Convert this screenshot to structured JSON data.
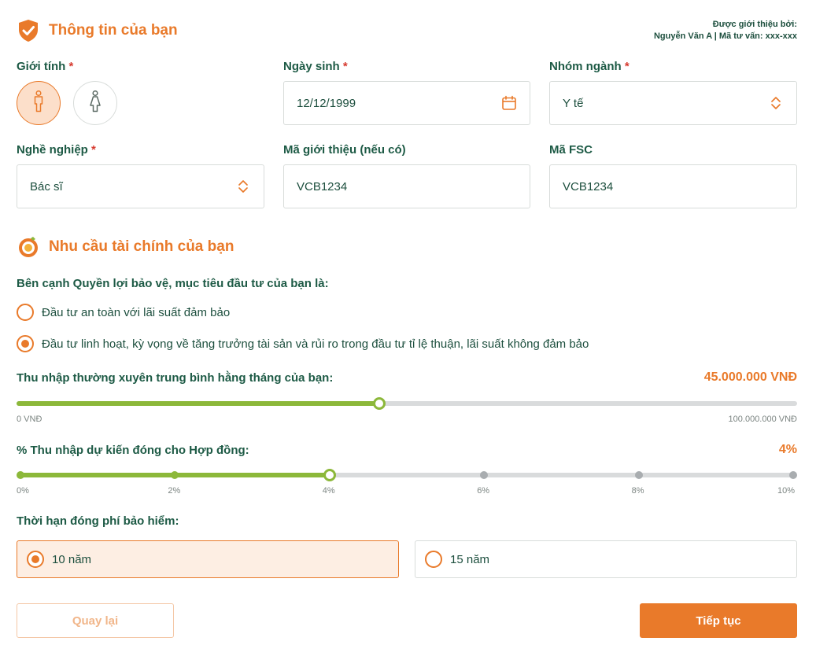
{
  "section1": {
    "title": "Thông tin của bạn",
    "icon": "shield-check-icon",
    "referral": {
      "line1": "Được giới thiệu bởi:",
      "line2": "Nguyễn Văn A | Mã tư vấn: xxx-xxx"
    }
  },
  "gender": {
    "label": "Giới tính",
    "required": "*",
    "options": [
      {
        "name": "male",
        "icon": "male-person-icon",
        "selected": true
      },
      {
        "name": "female",
        "icon": "female-person-icon",
        "selected": false
      }
    ]
  },
  "dob": {
    "label": "Ngày sinh",
    "required": "*",
    "value": "12/12/1999",
    "icon": "calendar-icon"
  },
  "industry": {
    "label": "Nhóm ngành",
    "required": "*",
    "value": "Y tế",
    "icon": "chevron-updown-icon"
  },
  "occupation": {
    "label": "Nghề nghiệp",
    "required": "*",
    "value": "Bác sĩ",
    "icon": "chevron-updown-icon"
  },
  "referral_code": {
    "label": "Mã giới thiệu (nếu có)",
    "value": "VCB1234"
  },
  "fsc_code": {
    "label": "Mã FSC",
    "value": "VCB1234"
  },
  "section2": {
    "title": "Nhu cầu tài chính của bạn",
    "icon": "target-money-icon"
  },
  "goal": {
    "question": "Bên cạnh Quyền lợi bảo vệ, mục tiêu đầu tư của bạn là:",
    "options": [
      {
        "label": "Đầu tư an toàn với lãi suất đảm bảo",
        "selected": false
      },
      {
        "label": "Đầu tư linh hoạt, kỳ vọng về tăng trưởng tài sản và rủi ro trong đầu tư tỉ lệ thuận, lãi suất không đảm bảo",
        "selected": true
      }
    ]
  },
  "income": {
    "label": "Thu nhập thường xuyên trung bình hằng tháng của bạn:",
    "value_text": "45.000.000 VNĐ",
    "value": 45000000,
    "min_label": "0 VNĐ",
    "max_label": "100.000.000 VNĐ",
    "fraction": 0.465
  },
  "contribution": {
    "label": "% Thu nhập dự kiến đóng cho Hợp đồng:",
    "value_text": "4%",
    "value": 4,
    "ticks": [
      "0%",
      "2%",
      "4%",
      "6%",
      "8%",
      "10%"
    ]
  },
  "term": {
    "label": "Thời hạn đóng phí bảo hiểm:",
    "options": [
      {
        "label": "10 năm",
        "selected": true
      },
      {
        "label": "15 năm",
        "selected": false
      }
    ]
  },
  "buttons": {
    "back": "Quay lại",
    "next": "Tiếp tục"
  },
  "colors": {
    "accent": "#e97a2a",
    "green": "#8cb83a",
    "text": "#1d5a45"
  }
}
